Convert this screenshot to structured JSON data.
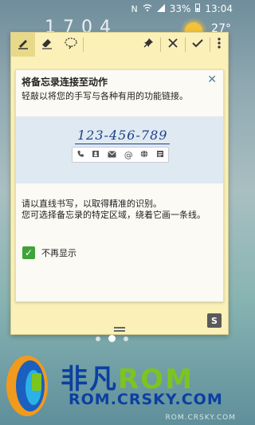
{
  "status_bar": {
    "battery": "33%",
    "time": "13:04"
  },
  "home": {
    "clock_partial": "1 7  0 4",
    "temperature": "27°"
  },
  "toolbar": {
    "items": [
      "pen-icon",
      "eraser-icon",
      "lasso-icon",
      "pin-icon",
      "close-icon",
      "done-icon",
      "more-icon"
    ]
  },
  "hint": {
    "title": "将备忘录连接至动作",
    "description": "轻敲以将您的手写与各种有用的功能链接。",
    "demo_number": "123-456-789",
    "demo_actions": [
      "phone-icon",
      "contact-icon",
      "email-icon",
      "at-icon",
      "browser-icon",
      "memo-icon"
    ],
    "info_line1": "请以直线书写，以取得精准的识别。",
    "info_line2": "您可选择备忘录的特定区域，绕着它画一条线。",
    "dont_show_label": "不再显示"
  },
  "watermark": {
    "main_left": "非凡",
    "main_right": "ROM",
    "sub": "ROM.CRSKY.COM",
    "small": "ROM.CRSKY.COM"
  }
}
